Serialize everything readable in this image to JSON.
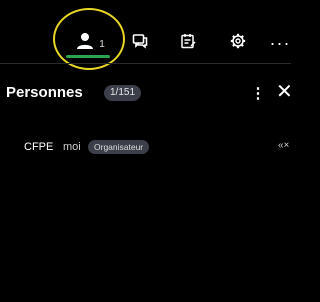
{
  "toolbar": {
    "people_count": "1",
    "more_label": "···",
    "underline_color": "#2ea44f",
    "highlight_color": "#e8d727",
    "icons": [
      "person-icon",
      "chat-icon",
      "notes-icon",
      "gear-icon",
      "more-icon"
    ]
  },
  "panel": {
    "title": "Personnes",
    "count": "1/151",
    "kebab_label": "⋮",
    "close_label": "✕"
  },
  "participants": [
    {
      "name": "CFPE",
      "me_label": "moi",
      "role": "Organisateur",
      "action_label": "«×"
    }
  ]
}
